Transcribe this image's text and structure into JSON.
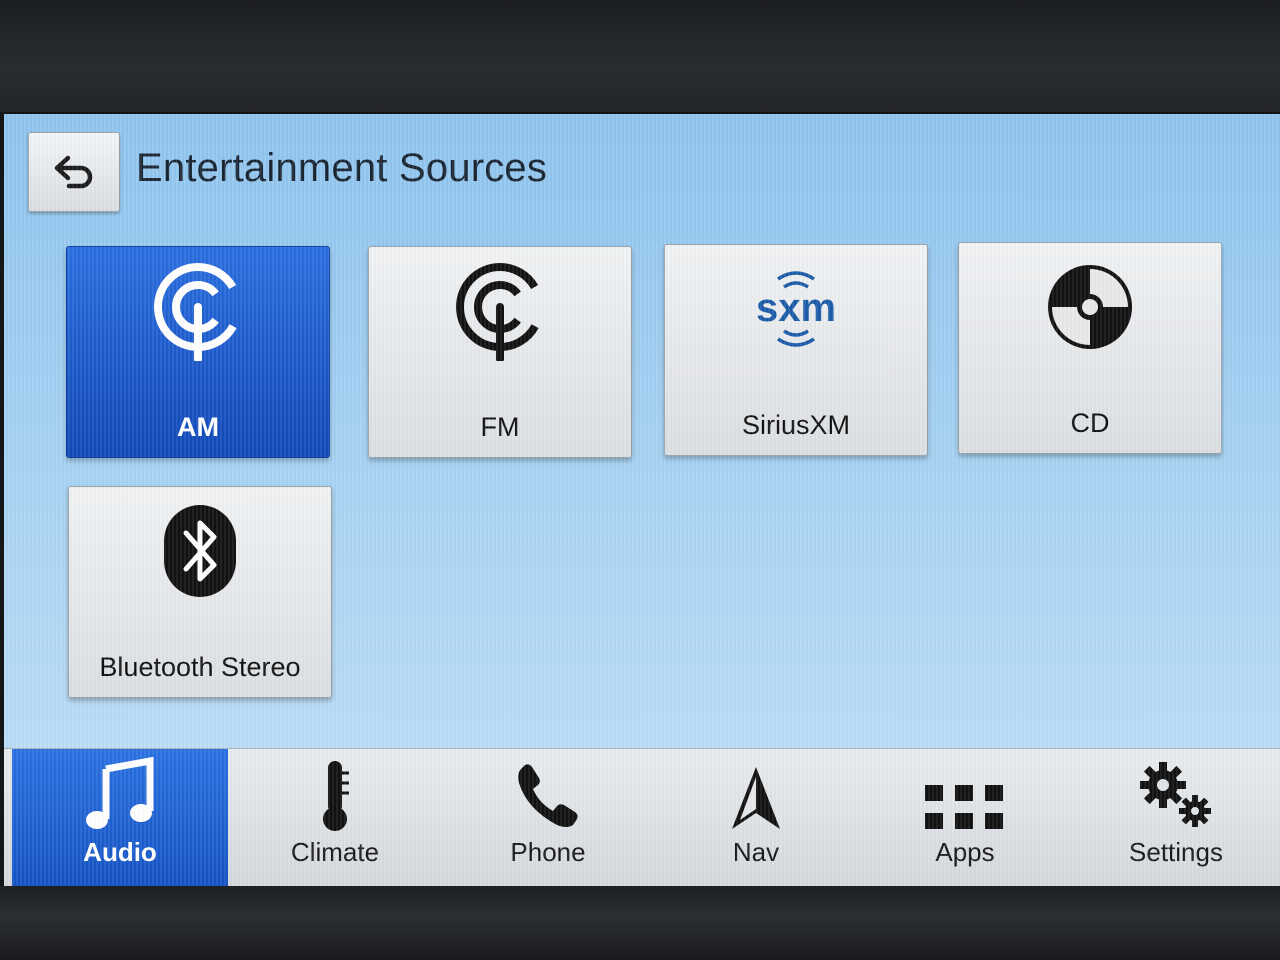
{
  "header": {
    "title": "Entertainment Sources",
    "back_icon": "back-arrow-icon"
  },
  "sources": [
    {
      "label": "AM",
      "icon": "am-radio-icon",
      "selected": true
    },
    {
      "label": "FM",
      "icon": "fm-radio-icon",
      "selected": false
    },
    {
      "label": "SiriusXM",
      "icon": "siriusxm-logo",
      "logo_text": "sxm",
      "selected": false
    },
    {
      "label": "CD",
      "icon": "cd-disc-icon",
      "selected": false
    },
    {
      "label": "Bluetooth Stereo",
      "icon": "bluetooth-icon",
      "selected": false
    }
  ],
  "bottom_nav": [
    {
      "label": "Audio",
      "icon": "music-note-icon",
      "active": true
    },
    {
      "label": "Climate",
      "icon": "thermometer-icon",
      "active": false
    },
    {
      "label": "Phone",
      "icon": "phone-handset-icon",
      "active": false
    },
    {
      "label": "Nav",
      "icon": "navigation-arrow-icon",
      "active": false
    },
    {
      "label": "Apps",
      "icon": "apps-grid-icon",
      "active": false
    },
    {
      "label": "Settings",
      "icon": "gears-icon",
      "active": false
    }
  ],
  "colors": {
    "accent": "#1a5cd0",
    "screen_bg": "#a6d2f3",
    "siriusxm_blue": "#1c5ca8"
  }
}
